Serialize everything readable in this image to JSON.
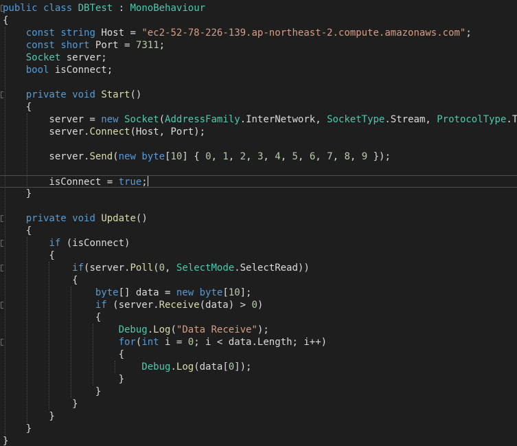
{
  "editor": {
    "theme_colors": {
      "background": "#1e1e1e",
      "keyword": "#569cd6",
      "type": "#4ec9b0",
      "string": "#d69d85",
      "number": "#b5cea8",
      "method": "#dcdcaa",
      "text": "#dcdcdc"
    },
    "lines": [
      [
        [
          "kw",
          "public"
        ],
        [
          "pl",
          " "
        ],
        [
          "kw",
          "class"
        ],
        [
          "pl",
          " "
        ],
        [
          "ty",
          "DBTest"
        ],
        [
          "pl",
          " : "
        ],
        [
          "ty",
          "MonoBehaviour"
        ]
      ],
      [
        [
          "pl",
          "{"
        ]
      ],
      [
        [
          "pl",
          "    "
        ],
        [
          "kw",
          "const"
        ],
        [
          "pl",
          " "
        ],
        [
          "kw",
          "string"
        ],
        [
          "pl",
          " Host = "
        ],
        [
          "st",
          "\"ec2-52-78-226-139.ap-northeast-2.compute.amazonaws.com\""
        ],
        [
          "pl",
          ";"
        ]
      ],
      [
        [
          "pl",
          "    "
        ],
        [
          "kw",
          "const"
        ],
        [
          "pl",
          " "
        ],
        [
          "kw",
          "short"
        ],
        [
          "pl",
          " Port = "
        ],
        [
          "nu",
          "7311"
        ],
        [
          "pl",
          ";"
        ]
      ],
      [
        [
          "pl",
          "    "
        ],
        [
          "ty",
          "Socket"
        ],
        [
          "pl",
          " server;"
        ]
      ],
      [
        [
          "pl",
          "    "
        ],
        [
          "kw",
          "bool"
        ],
        [
          "pl",
          " isConnect;"
        ]
      ],
      [],
      [
        [
          "pl",
          "    "
        ],
        [
          "kw",
          "private"
        ],
        [
          "pl",
          " "
        ],
        [
          "kw",
          "void"
        ],
        [
          "pl",
          " "
        ],
        [
          "me",
          "Start"
        ],
        [
          "pl",
          "()"
        ]
      ],
      [
        [
          "pl",
          "    {"
        ]
      ],
      [
        [
          "pl",
          "        server = "
        ],
        [
          "kw",
          "new"
        ],
        [
          "pl",
          " "
        ],
        [
          "ty",
          "Socket"
        ],
        [
          "pl",
          "("
        ],
        [
          "ty",
          "AddressFamily"
        ],
        [
          "pl",
          "."
        ],
        [
          "pl",
          "InterNetwork, "
        ],
        [
          "ty",
          "SocketType"
        ],
        [
          "pl",
          ".Stream, "
        ],
        [
          "ty",
          "ProtocolType"
        ],
        [
          "pl",
          ".Tcp);"
        ]
      ],
      [
        [
          "pl",
          "        server."
        ],
        [
          "me",
          "Connect"
        ],
        [
          "pl",
          "(Host, Port);"
        ]
      ],
      [],
      [
        [
          "pl",
          "        server."
        ],
        [
          "me",
          "Send"
        ],
        [
          "pl",
          "("
        ],
        [
          "kw",
          "new"
        ],
        [
          "pl",
          " "
        ],
        [
          "kw",
          "byte"
        ],
        [
          "pl",
          "["
        ],
        [
          "nu",
          "10"
        ],
        [
          "pl",
          "] { "
        ],
        [
          "nu",
          "0"
        ],
        [
          "pl",
          ", "
        ],
        [
          "nu",
          "1"
        ],
        [
          "pl",
          ", "
        ],
        [
          "nu",
          "2"
        ],
        [
          "pl",
          ", "
        ],
        [
          "nu",
          "3"
        ],
        [
          "pl",
          ", "
        ],
        [
          "nu",
          "4"
        ],
        [
          "pl",
          ", "
        ],
        [
          "nu",
          "5"
        ],
        [
          "pl",
          ", "
        ],
        [
          "nu",
          "6"
        ],
        [
          "pl",
          ", "
        ],
        [
          "nu",
          "7"
        ],
        [
          "pl",
          ", "
        ],
        [
          "nu",
          "8"
        ],
        [
          "pl",
          ", "
        ],
        [
          "nu",
          "9"
        ],
        [
          "pl",
          " });"
        ]
      ],
      [],
      [
        [
          "pl",
          "        isConnect = "
        ],
        [
          "kw",
          "true"
        ],
        [
          "pl",
          ";"
        ]
      ],
      [
        [
          "pl",
          "    }"
        ]
      ],
      [],
      [
        [
          "pl",
          "    "
        ],
        [
          "kw",
          "private"
        ],
        [
          "pl",
          " "
        ],
        [
          "kw",
          "void"
        ],
        [
          "pl",
          " "
        ],
        [
          "me",
          "Update"
        ],
        [
          "pl",
          "()"
        ]
      ],
      [
        [
          "pl",
          "    {"
        ]
      ],
      [
        [
          "pl",
          "        "
        ],
        [
          "kw",
          "if"
        ],
        [
          "pl",
          " (isConnect)"
        ]
      ],
      [
        [
          "pl",
          "        {"
        ]
      ],
      [
        [
          "pl",
          "            "
        ],
        [
          "kw",
          "if"
        ],
        [
          "pl",
          "(server."
        ],
        [
          "me",
          "Poll"
        ],
        [
          "pl",
          "("
        ],
        [
          "nu",
          "0"
        ],
        [
          "pl",
          ", "
        ],
        [
          "ty",
          "SelectMode"
        ],
        [
          "pl",
          ".SelectRead))"
        ]
      ],
      [
        [
          "pl",
          "            {"
        ]
      ],
      [
        [
          "pl",
          "                "
        ],
        [
          "kw",
          "byte"
        ],
        [
          "pl",
          "[] data = "
        ],
        [
          "kw",
          "new"
        ],
        [
          "pl",
          " "
        ],
        [
          "kw",
          "byte"
        ],
        [
          "pl",
          "["
        ],
        [
          "nu",
          "10"
        ],
        [
          "pl",
          "];"
        ]
      ],
      [
        [
          "pl",
          "                "
        ],
        [
          "kw",
          "if"
        ],
        [
          "pl",
          " (server."
        ],
        [
          "me",
          "Receive"
        ],
        [
          "pl",
          "(data) > "
        ],
        [
          "nu",
          "0"
        ],
        [
          "pl",
          ")"
        ]
      ],
      [
        [
          "pl",
          "                {"
        ]
      ],
      [
        [
          "pl",
          "                    "
        ],
        [
          "ty",
          "Debug"
        ],
        [
          "pl",
          "."
        ],
        [
          "me",
          "Log"
        ],
        [
          "pl",
          "("
        ],
        [
          "st",
          "\"Data Receive\""
        ],
        [
          "pl",
          ");"
        ]
      ],
      [
        [
          "pl",
          "                    "
        ],
        [
          "kw",
          "for"
        ],
        [
          "pl",
          "("
        ],
        [
          "kw",
          "int"
        ],
        [
          "pl",
          " i = "
        ],
        [
          "nu",
          "0"
        ],
        [
          "pl",
          "; i < data.Length; i++)"
        ]
      ],
      [
        [
          "pl",
          "                    {"
        ]
      ],
      [
        [
          "pl",
          "                        "
        ],
        [
          "ty",
          "Debug"
        ],
        [
          "pl",
          "."
        ],
        [
          "me",
          "Log"
        ],
        [
          "pl",
          "(data["
        ],
        [
          "nu",
          "0"
        ],
        [
          "pl",
          "]);"
        ]
      ],
      [
        [
          "pl",
          "                    }"
        ]
      ],
      [
        [
          "pl",
          "                }"
        ]
      ],
      [
        [
          "pl",
          "            }"
        ]
      ],
      [
        [
          "pl",
          "        }"
        ]
      ],
      [
        [
          "pl",
          "    }"
        ]
      ],
      [
        [
          "pl",
          "}"
        ]
      ]
    ],
    "current_line": 14
  }
}
